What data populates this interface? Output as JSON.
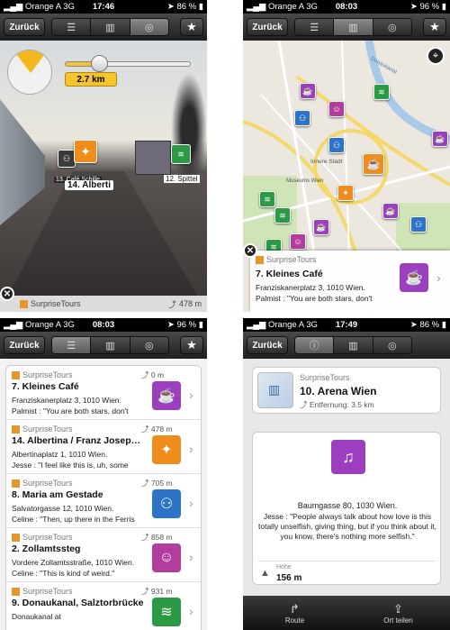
{
  "colors": {
    "purple": "#9c3fbf",
    "orange": "#ee8d1c",
    "blue": "#2d73c8",
    "green": "#2b9a45",
    "magenta": "#b33d9d"
  },
  "p1": {
    "status": {
      "carrier": "Orange A",
      "net": "3G",
      "time": "17:46",
      "battery": "86 %"
    },
    "toolbar": {
      "back": "Zurück"
    },
    "distance": "2.7 km",
    "labels": {
      "main": "14. Alberti",
      "back": "13. Café Schille",
      "right": "12. Spittel"
    },
    "footer": {
      "brand": "SurpriseTours",
      "distance": "478 m"
    }
  },
  "p2": {
    "status": {
      "carrier": "Orange A",
      "net": "3G",
      "time": "08:03",
      "battery": "96 %"
    },
    "toolbar": {
      "back": "Zurück"
    },
    "map_labels": [
      "Innere Stadt",
      "Museums Wien",
      "Donaukanal"
    ],
    "card": {
      "brand": "SurpriseTours",
      "title": "7. Kleines Café",
      "line1": "Franziskanerplatz 3, 1010 Wien.",
      "line2": "Palmist : \"You are both stars, don't"
    }
  },
  "p3": {
    "status": {
      "carrier": "Orange A",
      "net": "3G",
      "time": "08:03",
      "battery": "96 %"
    },
    "toolbar": {
      "back": "Zurück"
    },
    "items": [
      {
        "brand": "SurpriseTours",
        "dist": "0 m",
        "title": "7. Kleines Café",
        "line1": "Franziskanerplatz 3, 1010 Wien.",
        "line2": "Palmist : \"You are both stars, don't",
        "icon": "coffee-icon",
        "color": "#9c3fbf",
        "glyph": "☕"
      },
      {
        "brand": "SurpriseTours",
        "dist": "478 m",
        "title": "14. Albertina / Franz Josep…",
        "line1": "Albertinaplatz 1, 1010 Wien.",
        "line2": "Jesse : \"I feel like this is, uh, some",
        "icon": "group-icon",
        "color": "#ee8d1c",
        "glyph": "✦"
      },
      {
        "brand": "SurpriseTours",
        "dist": "705 m",
        "title": "8. Maria am Gestade",
        "line1": "Salvatorgasse 12, 1010 Wien.",
        "line2": "Celine : \"Then, up there in the Ferris",
        "icon": "people-icon",
        "color": "#2d73c8",
        "glyph": "⚇"
      },
      {
        "brand": "SurpriseTours",
        "dist": "858 m",
        "title": "2. Zollamtssteg",
        "line1": "Vordere Zollamtsstraße, 1010 Wien.",
        "line2": "Celine : \"This is kind of weird.\"",
        "icon": "theater-masks-icon",
        "color": "#b33d9d",
        "glyph": "☺"
      },
      {
        "brand": "SurpriseTours",
        "dist": "931 m",
        "title": "9. Donaukanal, Salztorbrücke",
        "line1": "Donaukanal at",
        "line2": "",
        "icon": "water-icon",
        "color": "#2b9a45",
        "glyph": "≋"
      }
    ]
  },
  "p4": {
    "status": {
      "carrier": "Orange A",
      "net": "3G",
      "time": "17:49",
      "battery": "86 %"
    },
    "toolbar": {
      "back": "Zurück"
    },
    "header": {
      "brand": "SurpriseTours",
      "title": "10. Arena Wien",
      "distance": "Entfernung: 3.5 km"
    },
    "address": "Baumgasse 80, 1030 Wien.",
    "quote": "Jesse : \"People always talk about how love is this totally unselfish, giving thing, but if you think about it, you know, there's nothing more selfish.\"",
    "height_label": "Höhe",
    "height": "156 m",
    "bottom": {
      "route": "Route",
      "share": "Ort teilen"
    }
  }
}
